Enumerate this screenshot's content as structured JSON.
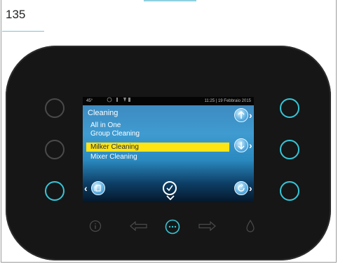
{
  "page": {
    "number": "135"
  },
  "screen": {
    "status": {
      "temperature": "45°",
      "datetime": "11:25 | 19 Febbraio 2015"
    },
    "menu": {
      "title": "Cleaning",
      "items": [
        {
          "label": "All in One",
          "selected": false
        },
        {
          "label": "Group Cleaning",
          "selected": false
        },
        {
          "label": "Milker Cleaning",
          "selected": true
        },
        {
          "label": "Mixer Cleaning",
          "selected": false
        }
      ]
    }
  },
  "colors": {
    "accent_lit": "#35c6d8",
    "selection": "#ffe413",
    "device_body": "#161616"
  },
  "icons": {
    "up": "arrow-up-icon",
    "down": "arrow-down-icon",
    "back": "back-page-icon",
    "confirm": "checkmark-icon",
    "refresh": "refresh-icon",
    "info": "info-icon",
    "left": "left-arrow-icon",
    "menu": "more-icon",
    "right": "right-arrow-icon",
    "water": "drop-icon"
  }
}
